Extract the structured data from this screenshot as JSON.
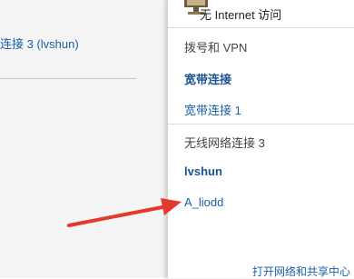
{
  "left_panel": {
    "connection_link": "连接 3 (lvshun)"
  },
  "popup": {
    "status": "无 Internet 访问",
    "dialup_section": {
      "heading": "拨号和 VPN",
      "items": [
        "宽带连接",
        "宽带连接 1"
      ]
    },
    "wireless_section": {
      "heading": "无线网络连接 3",
      "items": [
        "lvshun",
        "A_liodd"
      ]
    },
    "footer_link": "打开网络和共享中心"
  },
  "colors": {
    "link": "#1a5fa8",
    "arrow": "#e23a2e"
  }
}
